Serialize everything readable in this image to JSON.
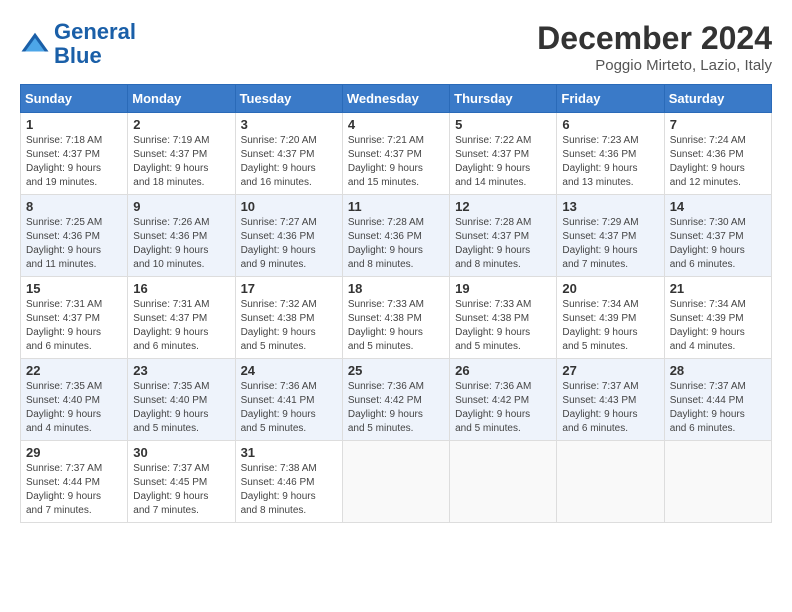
{
  "logo": {
    "line1": "General",
    "line2": "Blue"
  },
  "title": "December 2024",
  "location": "Poggio Mirteto, Lazio, Italy",
  "headers": [
    "Sunday",
    "Monday",
    "Tuesday",
    "Wednesday",
    "Thursday",
    "Friday",
    "Saturday"
  ],
  "weeks": [
    [
      {
        "day": "1",
        "info": "Sunrise: 7:18 AM\nSunset: 4:37 PM\nDaylight: 9 hours\nand 19 minutes."
      },
      {
        "day": "2",
        "info": "Sunrise: 7:19 AM\nSunset: 4:37 PM\nDaylight: 9 hours\nand 18 minutes."
      },
      {
        "day": "3",
        "info": "Sunrise: 7:20 AM\nSunset: 4:37 PM\nDaylight: 9 hours\nand 16 minutes."
      },
      {
        "day": "4",
        "info": "Sunrise: 7:21 AM\nSunset: 4:37 PM\nDaylight: 9 hours\nand 15 minutes."
      },
      {
        "day": "5",
        "info": "Sunrise: 7:22 AM\nSunset: 4:37 PM\nDaylight: 9 hours\nand 14 minutes."
      },
      {
        "day": "6",
        "info": "Sunrise: 7:23 AM\nSunset: 4:36 PM\nDaylight: 9 hours\nand 13 minutes."
      },
      {
        "day": "7",
        "info": "Sunrise: 7:24 AM\nSunset: 4:36 PM\nDaylight: 9 hours\nand 12 minutes."
      }
    ],
    [
      {
        "day": "8",
        "info": "Sunrise: 7:25 AM\nSunset: 4:36 PM\nDaylight: 9 hours\nand 11 minutes."
      },
      {
        "day": "9",
        "info": "Sunrise: 7:26 AM\nSunset: 4:36 PM\nDaylight: 9 hours\nand 10 minutes."
      },
      {
        "day": "10",
        "info": "Sunrise: 7:27 AM\nSunset: 4:36 PM\nDaylight: 9 hours\nand 9 minutes."
      },
      {
        "day": "11",
        "info": "Sunrise: 7:28 AM\nSunset: 4:36 PM\nDaylight: 9 hours\nand 8 minutes."
      },
      {
        "day": "12",
        "info": "Sunrise: 7:28 AM\nSunset: 4:37 PM\nDaylight: 9 hours\nand 8 minutes."
      },
      {
        "day": "13",
        "info": "Sunrise: 7:29 AM\nSunset: 4:37 PM\nDaylight: 9 hours\nand 7 minutes."
      },
      {
        "day": "14",
        "info": "Sunrise: 7:30 AM\nSunset: 4:37 PM\nDaylight: 9 hours\nand 6 minutes."
      }
    ],
    [
      {
        "day": "15",
        "info": "Sunrise: 7:31 AM\nSunset: 4:37 PM\nDaylight: 9 hours\nand 6 minutes."
      },
      {
        "day": "16",
        "info": "Sunrise: 7:31 AM\nSunset: 4:37 PM\nDaylight: 9 hours\nand 6 minutes."
      },
      {
        "day": "17",
        "info": "Sunrise: 7:32 AM\nSunset: 4:38 PM\nDaylight: 9 hours\nand 5 minutes."
      },
      {
        "day": "18",
        "info": "Sunrise: 7:33 AM\nSunset: 4:38 PM\nDaylight: 9 hours\nand 5 minutes."
      },
      {
        "day": "19",
        "info": "Sunrise: 7:33 AM\nSunset: 4:38 PM\nDaylight: 9 hours\nand 5 minutes."
      },
      {
        "day": "20",
        "info": "Sunrise: 7:34 AM\nSunset: 4:39 PM\nDaylight: 9 hours\nand 5 minutes."
      },
      {
        "day": "21",
        "info": "Sunrise: 7:34 AM\nSunset: 4:39 PM\nDaylight: 9 hours\nand 4 minutes."
      }
    ],
    [
      {
        "day": "22",
        "info": "Sunrise: 7:35 AM\nSunset: 4:40 PM\nDaylight: 9 hours\nand 4 minutes."
      },
      {
        "day": "23",
        "info": "Sunrise: 7:35 AM\nSunset: 4:40 PM\nDaylight: 9 hours\nand 5 minutes."
      },
      {
        "day": "24",
        "info": "Sunrise: 7:36 AM\nSunset: 4:41 PM\nDaylight: 9 hours\nand 5 minutes."
      },
      {
        "day": "25",
        "info": "Sunrise: 7:36 AM\nSunset: 4:42 PM\nDaylight: 9 hours\nand 5 minutes."
      },
      {
        "day": "26",
        "info": "Sunrise: 7:36 AM\nSunset: 4:42 PM\nDaylight: 9 hours\nand 5 minutes."
      },
      {
        "day": "27",
        "info": "Sunrise: 7:37 AM\nSunset: 4:43 PM\nDaylight: 9 hours\nand 6 minutes."
      },
      {
        "day": "28",
        "info": "Sunrise: 7:37 AM\nSunset: 4:44 PM\nDaylight: 9 hours\nand 6 minutes."
      }
    ],
    [
      {
        "day": "29",
        "info": "Sunrise: 7:37 AM\nSunset: 4:44 PM\nDaylight: 9 hours\nand 7 minutes."
      },
      {
        "day": "30",
        "info": "Sunrise: 7:37 AM\nSunset: 4:45 PM\nDaylight: 9 hours\nand 7 minutes."
      },
      {
        "day": "31",
        "info": "Sunrise: 7:38 AM\nSunset: 4:46 PM\nDaylight: 9 hours\nand 8 minutes."
      },
      {
        "day": "",
        "info": ""
      },
      {
        "day": "",
        "info": ""
      },
      {
        "day": "",
        "info": ""
      },
      {
        "day": "",
        "info": ""
      }
    ]
  ]
}
